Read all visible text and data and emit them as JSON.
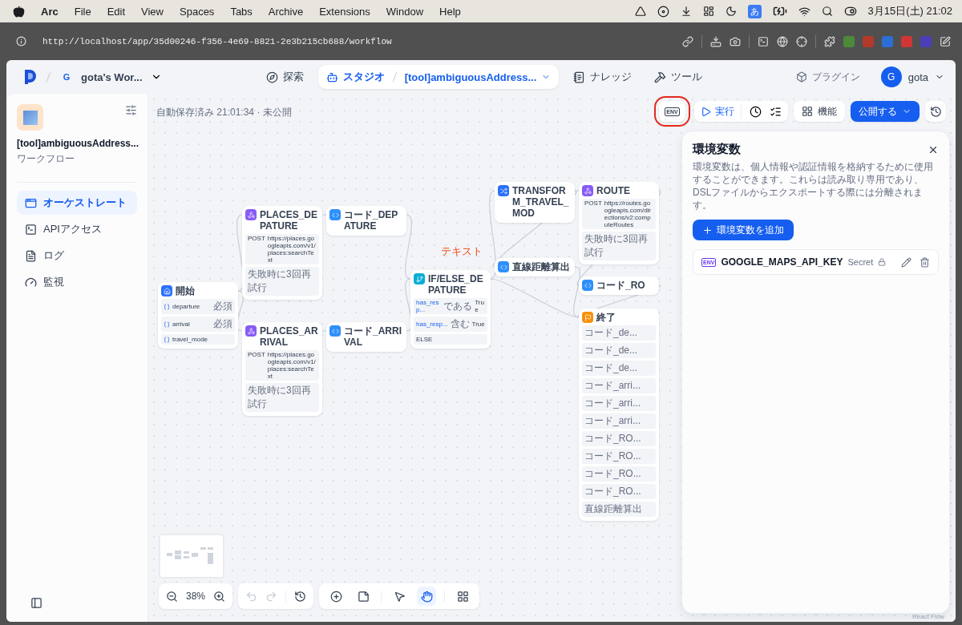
{
  "menu_bar": {
    "app": "Arc",
    "items": [
      "File",
      "Edit",
      "View",
      "Spaces",
      "Tabs",
      "Archive",
      "Extensions",
      "Window",
      "Help"
    ],
    "input_method": "あ",
    "clock": "3月15日(土) 21:02"
  },
  "browser": {
    "url": "http://localhost/app/35d00246-f356-4e69-8821-2e3b215cb688/workflow"
  },
  "header": {
    "workspace_initial": "G",
    "workspace": "gota's Wor...",
    "nav": [
      {
        "kind": "explore",
        "label": "探索",
        "selected": false
      },
      {
        "kind": "studio",
        "label": "スタジオ",
        "selected": true,
        "app": "[tool]ambiguousAddress..."
      },
      {
        "kind": "knowledge",
        "label": "ナレッジ",
        "selected": false
      },
      {
        "kind": "tools",
        "label": "ツール",
        "selected": false
      }
    ],
    "plugin": "プラグイン",
    "user_initial": "G",
    "user": "gota"
  },
  "sidebar": {
    "app_name": "[tool]ambiguousAddress...",
    "app_type": "ワークフロー",
    "items": [
      {
        "kind": "orchestrate",
        "label": "オーケストレート",
        "selected": true
      },
      {
        "kind": "api",
        "label": "APIアクセス",
        "selected": false
      },
      {
        "kind": "logs",
        "label": "ログ",
        "selected": false
      },
      {
        "kind": "monitor",
        "label": "監視",
        "selected": false
      }
    ]
  },
  "canvas": {
    "status": "自動保存済み 21:01:34 · 未公開",
    "toolbar": {
      "env": {
        "label": "ENV",
        "highlighted": true
      },
      "run": "実行",
      "features": "機能",
      "publish": "公開する"
    },
    "nodes": [
      {
        "kind": "start",
        "title": "開始",
        "rows": [
          {
            "name": "departure",
            "tag": "必須"
          },
          {
            "name": "arrival",
            "tag": "必須"
          },
          {
            "name": "travel_mode"
          }
        ]
      },
      {
        "kind": "http",
        "title": "PLACES_DEPATURE",
        "method": "POST",
        "url": "https://places.googleapis.com/v1/places:searchText",
        "retry": "失敗時に3回再試行"
      },
      {
        "kind": "code",
        "title": "コード_DEPATURE"
      },
      {
        "kind": "http",
        "title": "PLACES_ARRIVAL",
        "method": "POST",
        "url": "https://places.googleapis.com/v1/places:searchText",
        "retry": "失敗時に3回再試行"
      },
      {
        "kind": "code",
        "title": "コード_ARRIVAL"
      },
      {
        "kind": "ifelse",
        "title": "IF/ELSE_DEPATURE",
        "conditions": [
          {
            "variable": "has_resp...",
            "operator": "である",
            "value": "True"
          },
          {
            "variable": "has_resp...",
            "operator": "含む",
            "value": "True"
          }
        ],
        "else": "ELSE"
      },
      {
        "kind": "template",
        "title": "TRANSFORM_TRAVEL_MOD"
      },
      {
        "kind": "http",
        "title": "ROUTE",
        "method": "POST",
        "url": "https://routes.googleapis.com/directions/v2:computeRoutes",
        "retry": "失敗時に3回再試行"
      },
      {
        "kind": "code",
        "title": "直線距離算出"
      },
      {
        "kind": "code",
        "title": "コード_RO"
      },
      {
        "kind": "end",
        "title": "終了",
        "rows": [
          "コード_de...",
          "コード_de...",
          "コード_de...",
          "コード_arri...",
          "コード_arri...",
          "コード_arri...",
          "コード_RO...",
          "コード_RO...",
          "コード_RO...",
          "コード_RO...",
          "直線距離算出"
        ]
      }
    ],
    "annotation": "テキスト",
    "zoom": "38%",
    "tools": [
      {
        "kind": "add",
        "selected": false
      },
      {
        "kind": "note",
        "selected": false
      },
      {
        "kind": "pointer",
        "selected": false
      },
      {
        "kind": "hand",
        "selected": true
      },
      {
        "kind": "organize",
        "selected": false
      }
    ],
    "attribution": "React Flow"
  },
  "env_panel": {
    "title": "環境変数",
    "description": "環境変数は、個人情報や認証情報を格納するために使用することができます。これらは読み取り専用であり、DSLファイルからエクスポートする際には分離されます。",
    "add_button": "環境変数を追加",
    "variables": [
      {
        "badge": "ENV",
        "name": "GOOGLE_MAPS_API_KEY",
        "type": "Secret"
      }
    ]
  }
}
